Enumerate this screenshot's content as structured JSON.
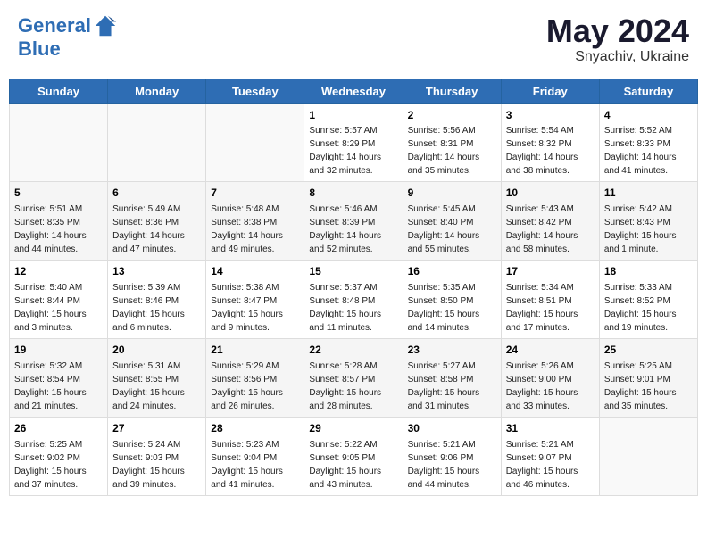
{
  "header": {
    "logo_line1": "General",
    "logo_line2": "Blue",
    "month_year": "May 2024",
    "location": "Snyachiv, Ukraine"
  },
  "days_of_week": [
    "Sunday",
    "Monday",
    "Tuesday",
    "Wednesday",
    "Thursday",
    "Friday",
    "Saturday"
  ],
  "weeks": [
    [
      {
        "day": "",
        "sunrise": "",
        "sunset": "",
        "daylight": ""
      },
      {
        "day": "",
        "sunrise": "",
        "sunset": "",
        "daylight": ""
      },
      {
        "day": "",
        "sunrise": "",
        "sunset": "",
        "daylight": ""
      },
      {
        "day": "1",
        "sunrise": "Sunrise: 5:57 AM",
        "sunset": "Sunset: 8:29 PM",
        "daylight": "Daylight: 14 hours and 32 minutes."
      },
      {
        "day": "2",
        "sunrise": "Sunrise: 5:56 AM",
        "sunset": "Sunset: 8:31 PM",
        "daylight": "Daylight: 14 hours and 35 minutes."
      },
      {
        "day": "3",
        "sunrise": "Sunrise: 5:54 AM",
        "sunset": "Sunset: 8:32 PM",
        "daylight": "Daylight: 14 hours and 38 minutes."
      },
      {
        "day": "4",
        "sunrise": "Sunrise: 5:52 AM",
        "sunset": "Sunset: 8:33 PM",
        "daylight": "Daylight: 14 hours and 41 minutes."
      }
    ],
    [
      {
        "day": "5",
        "sunrise": "Sunrise: 5:51 AM",
        "sunset": "Sunset: 8:35 PM",
        "daylight": "Daylight: 14 hours and 44 minutes."
      },
      {
        "day": "6",
        "sunrise": "Sunrise: 5:49 AM",
        "sunset": "Sunset: 8:36 PM",
        "daylight": "Daylight: 14 hours and 47 minutes."
      },
      {
        "day": "7",
        "sunrise": "Sunrise: 5:48 AM",
        "sunset": "Sunset: 8:38 PM",
        "daylight": "Daylight: 14 hours and 49 minutes."
      },
      {
        "day": "8",
        "sunrise": "Sunrise: 5:46 AM",
        "sunset": "Sunset: 8:39 PM",
        "daylight": "Daylight: 14 hours and 52 minutes."
      },
      {
        "day": "9",
        "sunrise": "Sunrise: 5:45 AM",
        "sunset": "Sunset: 8:40 PM",
        "daylight": "Daylight: 14 hours and 55 minutes."
      },
      {
        "day": "10",
        "sunrise": "Sunrise: 5:43 AM",
        "sunset": "Sunset: 8:42 PM",
        "daylight": "Daylight: 14 hours and 58 minutes."
      },
      {
        "day": "11",
        "sunrise": "Sunrise: 5:42 AM",
        "sunset": "Sunset: 8:43 PM",
        "daylight": "Daylight: 15 hours and 1 minute."
      }
    ],
    [
      {
        "day": "12",
        "sunrise": "Sunrise: 5:40 AM",
        "sunset": "Sunset: 8:44 PM",
        "daylight": "Daylight: 15 hours and 3 minutes."
      },
      {
        "day": "13",
        "sunrise": "Sunrise: 5:39 AM",
        "sunset": "Sunset: 8:46 PM",
        "daylight": "Daylight: 15 hours and 6 minutes."
      },
      {
        "day": "14",
        "sunrise": "Sunrise: 5:38 AM",
        "sunset": "Sunset: 8:47 PM",
        "daylight": "Daylight: 15 hours and 9 minutes."
      },
      {
        "day": "15",
        "sunrise": "Sunrise: 5:37 AM",
        "sunset": "Sunset: 8:48 PM",
        "daylight": "Daylight: 15 hours and 11 minutes."
      },
      {
        "day": "16",
        "sunrise": "Sunrise: 5:35 AM",
        "sunset": "Sunset: 8:50 PM",
        "daylight": "Daylight: 15 hours and 14 minutes."
      },
      {
        "day": "17",
        "sunrise": "Sunrise: 5:34 AM",
        "sunset": "Sunset: 8:51 PM",
        "daylight": "Daylight: 15 hours and 17 minutes."
      },
      {
        "day": "18",
        "sunrise": "Sunrise: 5:33 AM",
        "sunset": "Sunset: 8:52 PM",
        "daylight": "Daylight: 15 hours and 19 minutes."
      }
    ],
    [
      {
        "day": "19",
        "sunrise": "Sunrise: 5:32 AM",
        "sunset": "Sunset: 8:54 PM",
        "daylight": "Daylight: 15 hours and 21 minutes."
      },
      {
        "day": "20",
        "sunrise": "Sunrise: 5:31 AM",
        "sunset": "Sunset: 8:55 PM",
        "daylight": "Daylight: 15 hours and 24 minutes."
      },
      {
        "day": "21",
        "sunrise": "Sunrise: 5:29 AM",
        "sunset": "Sunset: 8:56 PM",
        "daylight": "Daylight: 15 hours and 26 minutes."
      },
      {
        "day": "22",
        "sunrise": "Sunrise: 5:28 AM",
        "sunset": "Sunset: 8:57 PM",
        "daylight": "Daylight: 15 hours and 28 minutes."
      },
      {
        "day": "23",
        "sunrise": "Sunrise: 5:27 AM",
        "sunset": "Sunset: 8:58 PM",
        "daylight": "Daylight: 15 hours and 31 minutes."
      },
      {
        "day": "24",
        "sunrise": "Sunrise: 5:26 AM",
        "sunset": "Sunset: 9:00 PM",
        "daylight": "Daylight: 15 hours and 33 minutes."
      },
      {
        "day": "25",
        "sunrise": "Sunrise: 5:25 AM",
        "sunset": "Sunset: 9:01 PM",
        "daylight": "Daylight: 15 hours and 35 minutes."
      }
    ],
    [
      {
        "day": "26",
        "sunrise": "Sunrise: 5:25 AM",
        "sunset": "Sunset: 9:02 PM",
        "daylight": "Daylight: 15 hours and 37 minutes."
      },
      {
        "day": "27",
        "sunrise": "Sunrise: 5:24 AM",
        "sunset": "Sunset: 9:03 PM",
        "daylight": "Daylight: 15 hours and 39 minutes."
      },
      {
        "day": "28",
        "sunrise": "Sunrise: 5:23 AM",
        "sunset": "Sunset: 9:04 PM",
        "daylight": "Daylight: 15 hours and 41 minutes."
      },
      {
        "day": "29",
        "sunrise": "Sunrise: 5:22 AM",
        "sunset": "Sunset: 9:05 PM",
        "daylight": "Daylight: 15 hours and 43 minutes."
      },
      {
        "day": "30",
        "sunrise": "Sunrise: 5:21 AM",
        "sunset": "Sunset: 9:06 PM",
        "daylight": "Daylight: 15 hours and 44 minutes."
      },
      {
        "day": "31",
        "sunrise": "Sunrise: 5:21 AM",
        "sunset": "Sunset: 9:07 PM",
        "daylight": "Daylight: 15 hours and 46 minutes."
      },
      {
        "day": "",
        "sunrise": "",
        "sunset": "",
        "daylight": ""
      }
    ]
  ]
}
